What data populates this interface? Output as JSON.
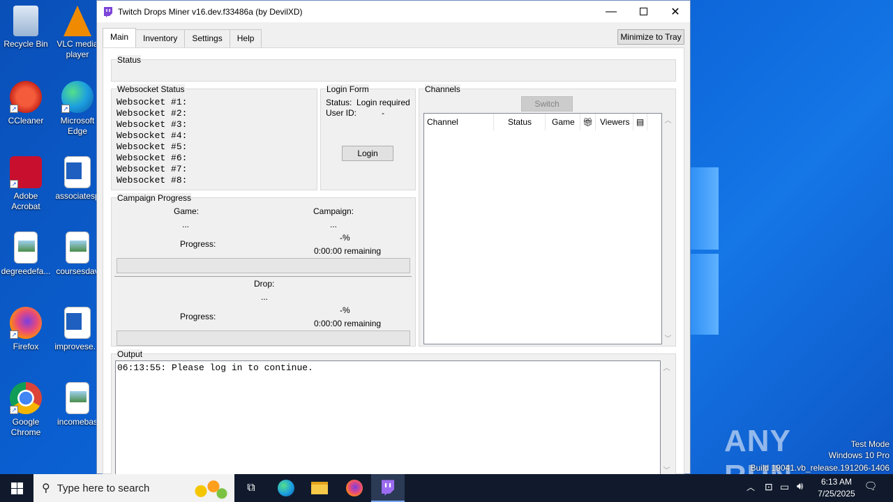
{
  "desktop": {
    "icons": [
      {
        "label": "Recycle Bin"
      },
      {
        "label": "VLC media player"
      },
      {
        "label": "CCleaner"
      },
      {
        "label": "Microsoft Edge"
      },
      {
        "label": "Adobe Acrobat"
      },
      {
        "label": "associatesp"
      },
      {
        "label": "degreedefa..."
      },
      {
        "label": "coursesdav"
      },
      {
        "label": "Firefox"
      },
      {
        "label": "improvese..."
      },
      {
        "label": "Google Chrome"
      },
      {
        "label": "incomebas"
      }
    ]
  },
  "window": {
    "title": "Twitch Drops Miner v16.dev.f33486a (by DevilXD)",
    "tabs": [
      "Main",
      "Inventory",
      "Settings",
      "Help"
    ],
    "minimize_to_tray": "Minimize to Tray",
    "status_frame": {
      "label": "Status",
      "text": ""
    },
    "websocket": {
      "label": "Websocket Status",
      "lines": [
        "Websocket #1:",
        "Websocket #2:",
        "Websocket #3:",
        "Websocket #4:",
        "Websocket #5:",
        "Websocket #6:",
        "Websocket #7:",
        "Websocket #8:"
      ]
    },
    "login": {
      "label": "Login Form",
      "status_label": "Status:",
      "status_value": "Login required",
      "userid_label": "User ID:",
      "userid_value": "-",
      "button": "Login"
    },
    "campaign": {
      "label": "Campaign Progress",
      "game_label": "Game:",
      "game_value": "...",
      "campaign_label": "Campaign:",
      "campaign_value": "...",
      "progress_label": "Progress:",
      "campaign_pct": "-%",
      "campaign_remaining": "0:00:00 remaining",
      "campaign_progress": 0,
      "drop_label": "Drop:",
      "drop_value": "...",
      "drop_progress_label": "Progress:",
      "drop_pct": "-%",
      "drop_remaining": "0:00:00 remaining",
      "drop_progress": 0
    },
    "channels": {
      "label": "Channels",
      "switch_button": "Switch",
      "columns": [
        "Channel",
        "Status",
        "Game",
        "Viewers"
      ],
      "rows": []
    },
    "output": {
      "label": "Output",
      "lines": [
        "06:13:55: Please log in to continue."
      ]
    }
  },
  "taskbar": {
    "search_placeholder": "Type here to search",
    "time": "6:13 AM",
    "date": "7/25/2025"
  },
  "watermark": {
    "brand": "ANY RUN",
    "line1": "Test Mode",
    "line2": "Windows 10 Pro",
    "line3": "Build 19041.vb_release.191206-1406"
  }
}
